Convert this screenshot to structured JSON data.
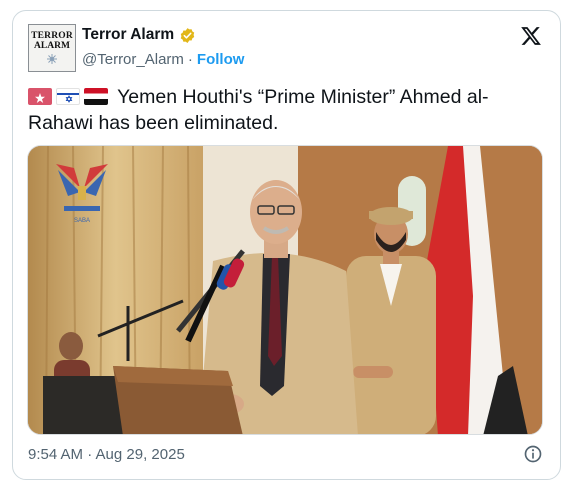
{
  "author": {
    "avatar_line1": "TERROR",
    "avatar_line2": "ALARM",
    "name": "Terror Alarm",
    "handle": "@Terror_Alarm",
    "separator": "·",
    "follow_label": "Follow"
  },
  "icons": {
    "verified": "verified-badge-icon",
    "platform": "x-logo-icon",
    "info": "info-icon",
    "flags": [
      "red-flag-emoji",
      "israel-flag-emoji",
      "yemen-flag-emoji"
    ]
  },
  "tweet": {
    "text": "Yemen Houthi's  “Prime Minister” Ahmed al-Rahawi has been eliminated."
  },
  "photo": {
    "logo_caption": "SABA"
  },
  "footer": {
    "timestamp": "9:54 AM · Aug 29, 2025"
  },
  "colors": {
    "accent": "#1d9bf0",
    "verified_gold": "#e2b719",
    "secondary_text": "#536471",
    "border": "#cfd9de"
  }
}
